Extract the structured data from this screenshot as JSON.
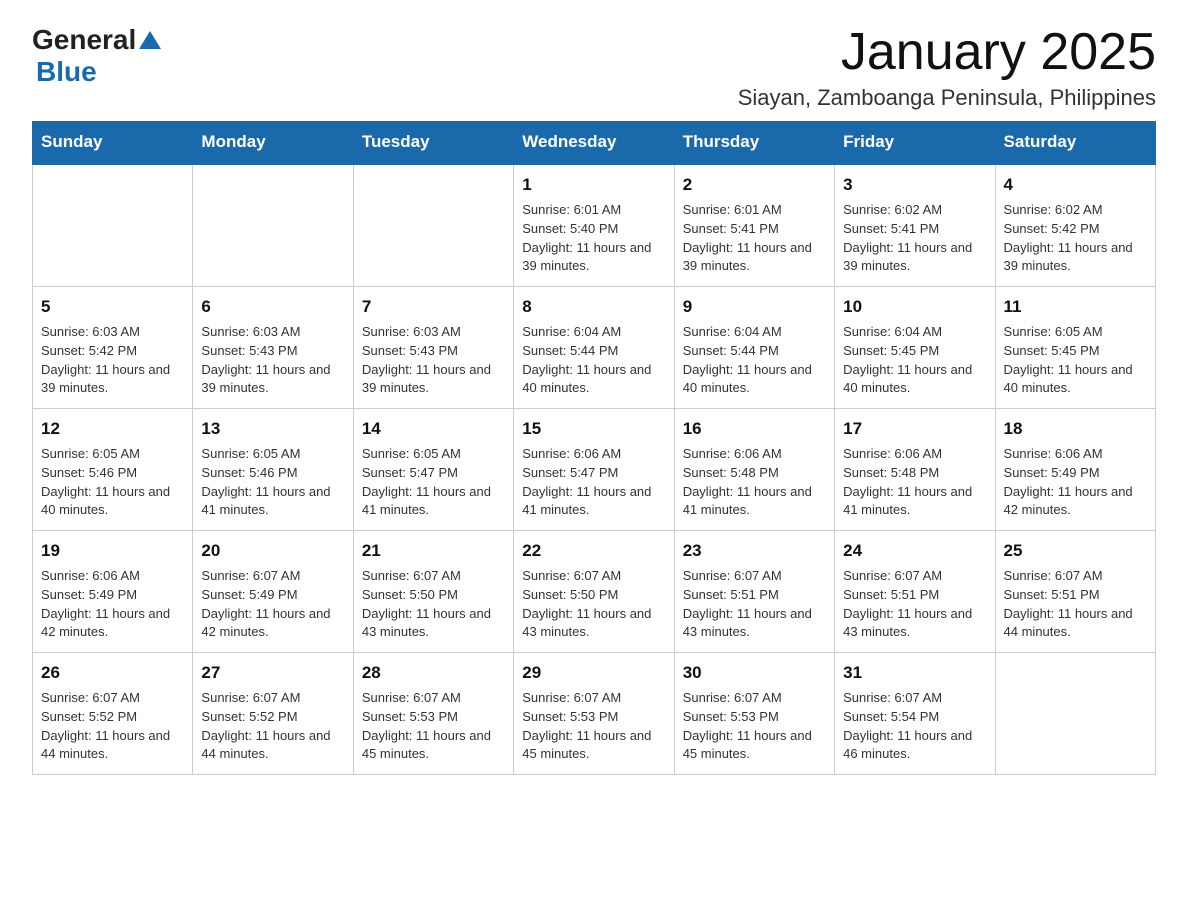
{
  "header": {
    "logo_general": "General",
    "logo_blue": "Blue",
    "title": "January 2025",
    "subtitle": "Siayan, Zamboanga Peninsula, Philippines"
  },
  "days_of_week": [
    "Sunday",
    "Monday",
    "Tuesday",
    "Wednesday",
    "Thursday",
    "Friday",
    "Saturday"
  ],
  "weeks": [
    [
      {
        "day": "",
        "sunrise": "",
        "sunset": "",
        "daylight": ""
      },
      {
        "day": "",
        "sunrise": "",
        "sunset": "",
        "daylight": ""
      },
      {
        "day": "",
        "sunrise": "",
        "sunset": "",
        "daylight": ""
      },
      {
        "day": "1",
        "sunrise": "Sunrise: 6:01 AM",
        "sunset": "Sunset: 5:40 PM",
        "daylight": "Daylight: 11 hours and 39 minutes."
      },
      {
        "day": "2",
        "sunrise": "Sunrise: 6:01 AM",
        "sunset": "Sunset: 5:41 PM",
        "daylight": "Daylight: 11 hours and 39 minutes."
      },
      {
        "day": "3",
        "sunrise": "Sunrise: 6:02 AM",
        "sunset": "Sunset: 5:41 PM",
        "daylight": "Daylight: 11 hours and 39 minutes."
      },
      {
        "day": "4",
        "sunrise": "Sunrise: 6:02 AM",
        "sunset": "Sunset: 5:42 PM",
        "daylight": "Daylight: 11 hours and 39 minutes."
      }
    ],
    [
      {
        "day": "5",
        "sunrise": "Sunrise: 6:03 AM",
        "sunset": "Sunset: 5:42 PM",
        "daylight": "Daylight: 11 hours and 39 minutes."
      },
      {
        "day": "6",
        "sunrise": "Sunrise: 6:03 AM",
        "sunset": "Sunset: 5:43 PM",
        "daylight": "Daylight: 11 hours and 39 minutes."
      },
      {
        "day": "7",
        "sunrise": "Sunrise: 6:03 AM",
        "sunset": "Sunset: 5:43 PM",
        "daylight": "Daylight: 11 hours and 39 minutes."
      },
      {
        "day": "8",
        "sunrise": "Sunrise: 6:04 AM",
        "sunset": "Sunset: 5:44 PM",
        "daylight": "Daylight: 11 hours and 40 minutes."
      },
      {
        "day": "9",
        "sunrise": "Sunrise: 6:04 AM",
        "sunset": "Sunset: 5:44 PM",
        "daylight": "Daylight: 11 hours and 40 minutes."
      },
      {
        "day": "10",
        "sunrise": "Sunrise: 6:04 AM",
        "sunset": "Sunset: 5:45 PM",
        "daylight": "Daylight: 11 hours and 40 minutes."
      },
      {
        "day": "11",
        "sunrise": "Sunrise: 6:05 AM",
        "sunset": "Sunset: 5:45 PM",
        "daylight": "Daylight: 11 hours and 40 minutes."
      }
    ],
    [
      {
        "day": "12",
        "sunrise": "Sunrise: 6:05 AM",
        "sunset": "Sunset: 5:46 PM",
        "daylight": "Daylight: 11 hours and 40 minutes."
      },
      {
        "day": "13",
        "sunrise": "Sunrise: 6:05 AM",
        "sunset": "Sunset: 5:46 PM",
        "daylight": "Daylight: 11 hours and 41 minutes."
      },
      {
        "day": "14",
        "sunrise": "Sunrise: 6:05 AM",
        "sunset": "Sunset: 5:47 PM",
        "daylight": "Daylight: 11 hours and 41 minutes."
      },
      {
        "day": "15",
        "sunrise": "Sunrise: 6:06 AM",
        "sunset": "Sunset: 5:47 PM",
        "daylight": "Daylight: 11 hours and 41 minutes."
      },
      {
        "day": "16",
        "sunrise": "Sunrise: 6:06 AM",
        "sunset": "Sunset: 5:48 PM",
        "daylight": "Daylight: 11 hours and 41 minutes."
      },
      {
        "day": "17",
        "sunrise": "Sunrise: 6:06 AM",
        "sunset": "Sunset: 5:48 PM",
        "daylight": "Daylight: 11 hours and 41 minutes."
      },
      {
        "day": "18",
        "sunrise": "Sunrise: 6:06 AM",
        "sunset": "Sunset: 5:49 PM",
        "daylight": "Daylight: 11 hours and 42 minutes."
      }
    ],
    [
      {
        "day": "19",
        "sunrise": "Sunrise: 6:06 AM",
        "sunset": "Sunset: 5:49 PM",
        "daylight": "Daylight: 11 hours and 42 minutes."
      },
      {
        "day": "20",
        "sunrise": "Sunrise: 6:07 AM",
        "sunset": "Sunset: 5:49 PM",
        "daylight": "Daylight: 11 hours and 42 minutes."
      },
      {
        "day": "21",
        "sunrise": "Sunrise: 6:07 AM",
        "sunset": "Sunset: 5:50 PM",
        "daylight": "Daylight: 11 hours and 43 minutes."
      },
      {
        "day": "22",
        "sunrise": "Sunrise: 6:07 AM",
        "sunset": "Sunset: 5:50 PM",
        "daylight": "Daylight: 11 hours and 43 minutes."
      },
      {
        "day": "23",
        "sunrise": "Sunrise: 6:07 AM",
        "sunset": "Sunset: 5:51 PM",
        "daylight": "Daylight: 11 hours and 43 minutes."
      },
      {
        "day": "24",
        "sunrise": "Sunrise: 6:07 AM",
        "sunset": "Sunset: 5:51 PM",
        "daylight": "Daylight: 11 hours and 43 minutes."
      },
      {
        "day": "25",
        "sunrise": "Sunrise: 6:07 AM",
        "sunset": "Sunset: 5:51 PM",
        "daylight": "Daylight: 11 hours and 44 minutes."
      }
    ],
    [
      {
        "day": "26",
        "sunrise": "Sunrise: 6:07 AM",
        "sunset": "Sunset: 5:52 PM",
        "daylight": "Daylight: 11 hours and 44 minutes."
      },
      {
        "day": "27",
        "sunrise": "Sunrise: 6:07 AM",
        "sunset": "Sunset: 5:52 PM",
        "daylight": "Daylight: 11 hours and 44 minutes."
      },
      {
        "day": "28",
        "sunrise": "Sunrise: 6:07 AM",
        "sunset": "Sunset: 5:53 PM",
        "daylight": "Daylight: 11 hours and 45 minutes."
      },
      {
        "day": "29",
        "sunrise": "Sunrise: 6:07 AM",
        "sunset": "Sunset: 5:53 PM",
        "daylight": "Daylight: 11 hours and 45 minutes."
      },
      {
        "day": "30",
        "sunrise": "Sunrise: 6:07 AM",
        "sunset": "Sunset: 5:53 PM",
        "daylight": "Daylight: 11 hours and 45 minutes."
      },
      {
        "day": "31",
        "sunrise": "Sunrise: 6:07 AM",
        "sunset": "Sunset: 5:54 PM",
        "daylight": "Daylight: 11 hours and 46 minutes."
      },
      {
        "day": "",
        "sunrise": "",
        "sunset": "",
        "daylight": ""
      }
    ]
  ]
}
